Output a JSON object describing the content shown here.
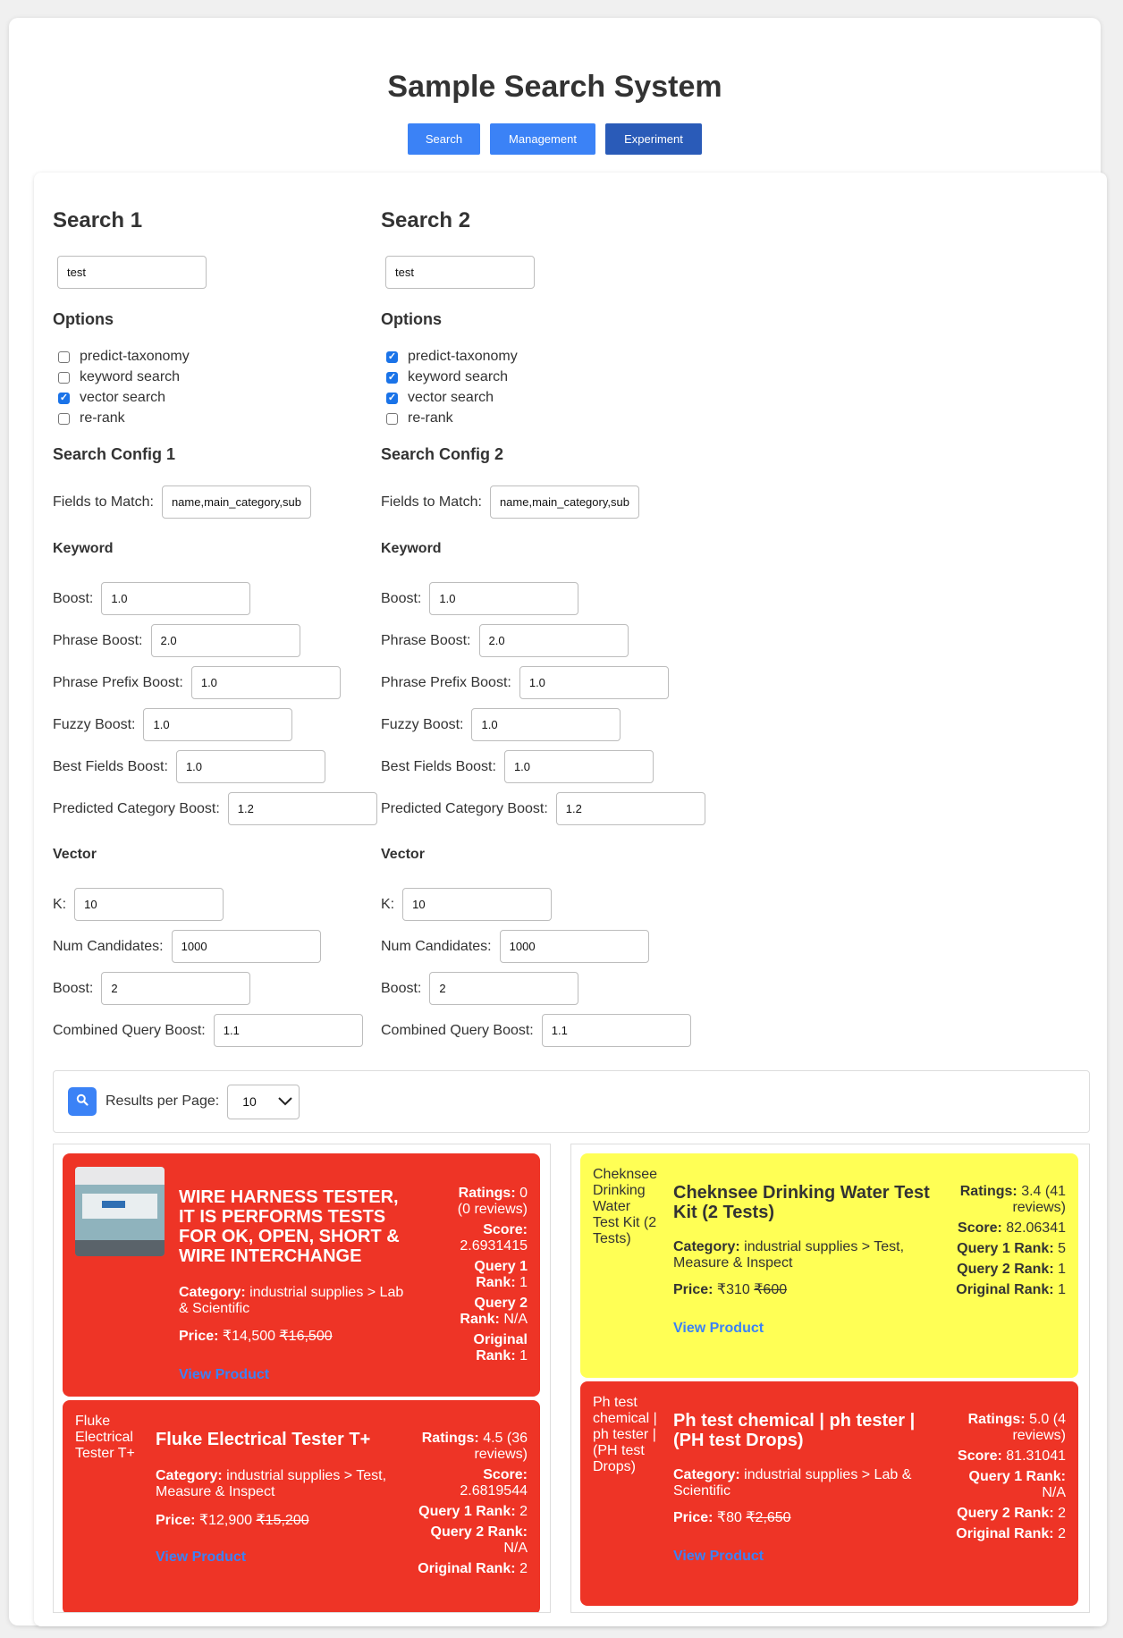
{
  "app": {
    "title": "Sample Search System",
    "nav": [
      {
        "label": "Search"
      },
      {
        "label": "Management"
      },
      {
        "label": "Experiment"
      }
    ]
  },
  "searches": [
    {
      "heading": "Search 1",
      "query": "test",
      "options_heading": "Options",
      "options": [
        {
          "label": "predict-taxonomy",
          "checked": false
        },
        {
          "label": "keyword search",
          "checked": false
        },
        {
          "label": "vector search",
          "checked": true
        },
        {
          "label": "re-rank",
          "checked": false
        }
      ],
      "config_heading": "Search Config 1",
      "fields_label": "Fields to Match:",
      "fields_value": "name,main_category,sub",
      "keyword_heading": "Keyword",
      "keyword": [
        {
          "label": "Boost:",
          "value": "1.0"
        },
        {
          "label": "Phrase Boost:",
          "value": "2.0"
        },
        {
          "label": "Phrase Prefix Boost:",
          "value": "1.0"
        },
        {
          "label": "Fuzzy Boost:",
          "value": "1.0"
        },
        {
          "label": "Best Fields Boost:",
          "value": "1.0"
        },
        {
          "label": "Predicted Category Boost:",
          "value": "1.2"
        }
      ],
      "vector_heading": "Vector",
      "vector": [
        {
          "label": "K:",
          "value": "10"
        },
        {
          "label": "Num Candidates:",
          "value": "1000"
        },
        {
          "label": "Boost:",
          "value": "2"
        },
        {
          "label": "Combined Query Boost:",
          "value": "1.1"
        }
      ]
    },
    {
      "heading": "Search 2",
      "query": "test",
      "options_heading": "Options",
      "options": [
        {
          "label": "predict-taxonomy",
          "checked": true
        },
        {
          "label": "keyword search",
          "checked": true
        },
        {
          "label": "vector search",
          "checked": true
        },
        {
          "label": "re-rank",
          "checked": false
        }
      ],
      "config_heading": "Search Config 2",
      "fields_label": "Fields to Match:",
      "fields_value": "name,main_category,sub",
      "keyword_heading": "Keyword",
      "keyword": [
        {
          "label": "Boost:",
          "value": "1.0"
        },
        {
          "label": "Phrase Boost:",
          "value": "2.0"
        },
        {
          "label": "Phrase Prefix Boost:",
          "value": "1.0"
        },
        {
          "label": "Fuzzy Boost:",
          "value": "1.0"
        },
        {
          "label": "Best Fields Boost:",
          "value": "1.0"
        },
        {
          "label": "Predicted Category Boost:",
          "value": "1.2"
        }
      ],
      "vector_heading": "Vector",
      "vector": [
        {
          "label": "K:",
          "value": "10"
        },
        {
          "label": "Num Candidates:",
          "value": "1000"
        },
        {
          "label": "Boost:",
          "value": "2"
        },
        {
          "label": "Combined Query Boost:",
          "value": "1.1"
        }
      ]
    }
  ],
  "toolbar": {
    "results_label": "Results per Page:",
    "results_value": "10",
    "search_icon": "search-icon",
    "dropdown_icon": "chevron-down-icon"
  },
  "results": [
    [
      {
        "name": "WIRE HARNESS TESTER, IT IS PERFORMS TESTS FOR OK, OPEN, SHORT & WIRE INTERCHANGE",
        "image_alt": "",
        "category_label": "Category:",
        "category": "industrial supplies > Lab & Scientific",
        "price_label": "Price:",
        "price": "₹14,500",
        "mrp": "₹16,500",
        "link": "View Product",
        "color": "#ee3426",
        "ratings": "0 (0 reviews)",
        "score": "2.6931415",
        "q1": "1",
        "q2": "N/A",
        "orig": "1"
      },
      {
        "name": "Fluke Electrical Tester T+",
        "image_alt": "Fluke Electrical Tester T+",
        "category_label": "Category:",
        "category": "industrial supplies > Test, Measure & Inspect",
        "price_label": "Price:",
        "price": "₹12,900",
        "mrp": "₹15,200",
        "link": "View Product",
        "color": "#ee3426",
        "ratings": "4.5 (36 reviews)",
        "score": "2.6819544",
        "q1": "2",
        "q2": "N/A",
        "orig": "2"
      }
    ],
    [
      {
        "name": "Cheknsee Drinking Water Test Kit (2 Tests)",
        "image_alt": "Cheknsee Drinking Water Test Kit (2 Tests)",
        "category_label": "Category:",
        "category": "industrial supplies > Test, Measure & Inspect",
        "price_label": "Price:",
        "price": "₹310",
        "mrp": "₹600",
        "link": "View Product",
        "color": "#ffff55",
        "ratings": "3.4 (41 reviews)",
        "score": "82.06341",
        "q1": "5",
        "q2": "1",
        "orig": "1"
      },
      {
        "name": "Ph test chemical | ph tester | (PH test Drops)",
        "image_alt": "Ph test chemical | ph tester | (PH test Drops)",
        "category_label": "Category:",
        "category": "industrial supplies > Lab & Scientific",
        "price_label": "Price:",
        "price": "₹80",
        "mrp": "₹2,650",
        "link": "View Product",
        "color": "#ee3426",
        "ratings": "5.0 (4 reviews)",
        "score": "81.31041",
        "q1": "N/A",
        "q2": "2",
        "orig": "2"
      }
    ]
  ],
  "stat_labels": {
    "ratings": "Ratings:",
    "score": "Score:",
    "q1": "Query 1 Rank:",
    "q2": "Query 2 Rank:",
    "orig": "Original Rank:"
  }
}
